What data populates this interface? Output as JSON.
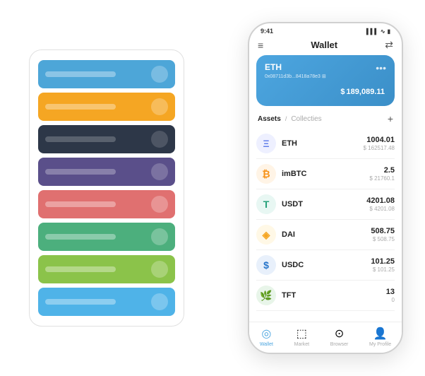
{
  "scene": {
    "background": "#ffffff"
  },
  "cardStack": {
    "cards": [
      {
        "color": "card-blue",
        "id": "blue"
      },
      {
        "color": "card-orange",
        "id": "orange"
      },
      {
        "color": "card-dark",
        "id": "dark"
      },
      {
        "color": "card-purple",
        "id": "purple"
      },
      {
        "color": "card-red",
        "id": "red"
      },
      {
        "color": "card-green",
        "id": "green"
      },
      {
        "color": "card-lime",
        "id": "lime"
      },
      {
        "color": "card-sky",
        "id": "sky"
      }
    ]
  },
  "phone": {
    "statusBar": {
      "time": "9:41",
      "signal": "▌▌▌",
      "wifi": "WiFi",
      "battery": "🔋"
    },
    "header": {
      "menuIcon": "≡",
      "title": "Wallet",
      "scanIcon": "⇄"
    },
    "ethCard": {
      "label": "ETH",
      "address": "0x08711d3b...8418a78e3  ⊞",
      "moreIcon": "•••",
      "currency": "$",
      "amount": "189,089.11"
    },
    "assetsSection": {
      "activeTab": "Assets",
      "separator": "/",
      "inactiveTab": "Collecties",
      "addIcon": "+"
    },
    "assets": [
      {
        "name": "ETH",
        "icon": "Ξ",
        "iconColor": "#627eea",
        "iconBg": "#eef0ff",
        "amount": "1004.01",
        "usd": "$ 162517.48"
      },
      {
        "name": "imBTC",
        "icon": "₿",
        "iconColor": "#f7931a",
        "iconBg": "#fff4e6",
        "amount": "2.5",
        "usd": "$ 21760.1"
      },
      {
        "name": "USDT",
        "icon": "T",
        "iconColor": "#26a17b",
        "iconBg": "#e8f7f3",
        "amount": "4201.08",
        "usd": "$ 4201.08"
      },
      {
        "name": "DAI",
        "icon": "◈",
        "iconColor": "#f5a623",
        "iconBg": "#fff8e6",
        "amount": "508.75",
        "usd": "$ 508.75"
      },
      {
        "name": "USDC",
        "icon": "$",
        "iconColor": "#2775ca",
        "iconBg": "#e8f0fb",
        "amount": "101.25",
        "usd": "$ 101.25"
      },
      {
        "name": "TFT",
        "icon": "🌿",
        "iconColor": "#4caf50",
        "iconBg": "#e8f5e9",
        "amount": "13",
        "usd": "0"
      }
    ],
    "bottomNav": [
      {
        "label": "Wallet",
        "icon": "◎",
        "active": true
      },
      {
        "label": "Market",
        "icon": "📊",
        "active": false
      },
      {
        "label": "Browser",
        "icon": "👤",
        "active": false
      },
      {
        "label": "My Profile",
        "icon": "👤",
        "active": false
      }
    ]
  }
}
